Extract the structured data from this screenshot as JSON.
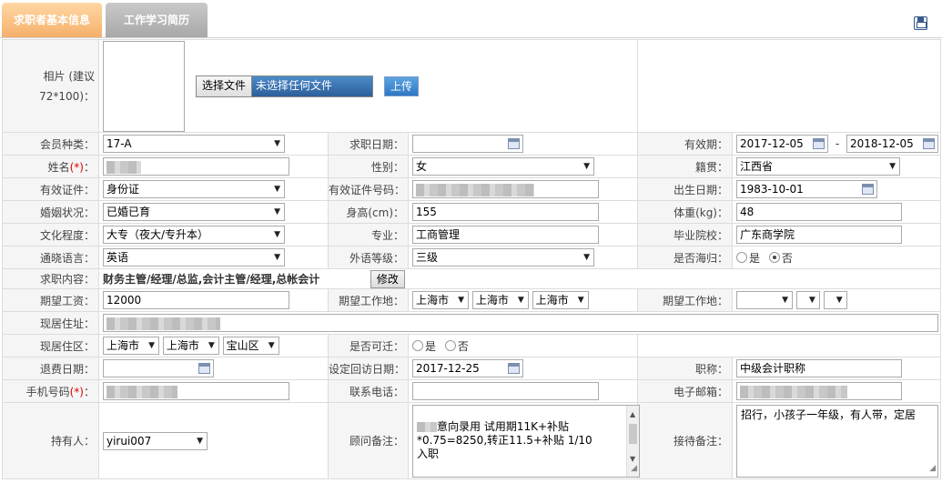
{
  "tabs": {
    "basic": "求职者基本信息",
    "resume": "工作学习简历"
  },
  "icons": {
    "save": "save-icon",
    "calendar": "calendar-icon",
    "dropdown": "dropdown-arrow-icon"
  },
  "photo": {
    "label": "相片 (建议72*100)：",
    "choose_btn": "选择文件",
    "no_file": "未选择任何文件",
    "upload_btn": "上传"
  },
  "row1": {
    "member_type_label": "会员种类：",
    "member_type": "17-A",
    "job_date_label": "求职日期：",
    "job_date": "",
    "valid_label": "有效期：",
    "valid_from": "2017-12-05",
    "valid_sep": "-",
    "valid_to": "2018-12-05"
  },
  "row2": {
    "name_label": "姓名",
    "req_mark": "(*)",
    "colon": "：",
    "gender_label": "性别：",
    "gender": "女",
    "native_label": "籍贯：",
    "native": "江西省"
  },
  "row3": {
    "id_type_label": "有效证件：",
    "id_type": "身份证",
    "id_no_label": "有效证件号码：",
    "birth_label": "出生日期：",
    "birth": "1983-10-01"
  },
  "row4": {
    "marital_label": "婚姻状况：",
    "marital": "已婚已育",
    "height_label": "身高(cm)：",
    "height": "155",
    "weight_label": "体重(kg)：",
    "weight": "48"
  },
  "row5": {
    "edu_label": "文化程度：",
    "edu": "大专（夜大/专升本）",
    "major_label": "专业：",
    "major": "工商管理",
    "school_label": "毕业院校：",
    "school": "广东商学院"
  },
  "row6": {
    "lang_label": "通晓语言：",
    "lang": "英语",
    "lang_level_label": "外语等级：",
    "lang_level": "三级",
    "overseas_label": "是否海归：",
    "yes": "是",
    "no": "否"
  },
  "row7": {
    "job_content_label": "求职内容：",
    "job_content": "财务主管/经理/总监,会计主管/经理,总帐会计",
    "edit_btn": "修改"
  },
  "row8": {
    "salary_label": "期望工资：",
    "salary": "12000",
    "work_place_label": "期望工作地：",
    "wp1": "上海市",
    "wp2": "上海市",
    "wp3": "上海市",
    "work_place2_label": "期望工作地："
  },
  "row9": {
    "address_label": "现居住址："
  },
  "row10": {
    "area_label": "现居住区：",
    "a1": "上海市",
    "a2": "上海市",
    "a3": "宝山区",
    "relocate_label": "是否可迁：",
    "yes": "是",
    "no": "否"
  },
  "row11": {
    "refund_label": "退费日期：",
    "refund": "",
    "revisit_label": "设定回访日期：",
    "revisit": "2017-12-25",
    "title_label": "职称：",
    "title": "中级会计职称"
  },
  "row12": {
    "mobile_label": "手机号码",
    "phone_label": "联系电话：",
    "phone": "",
    "email_label": "电子邮箱："
  },
  "row13": {
    "holder_label": "持有人：",
    "holder": "yirui007",
    "advisor_label": "顾问备注：",
    "advisor_note_1": "意向录用  试用期11K+补贴",
    "advisor_note_2": "*0.75=8250,转正11.5+补贴   1/10",
    "advisor_note_3": "入职",
    "reception_label": "接待备注：",
    "reception_note": "招行，小孩子一年级，有人带，定居"
  }
}
